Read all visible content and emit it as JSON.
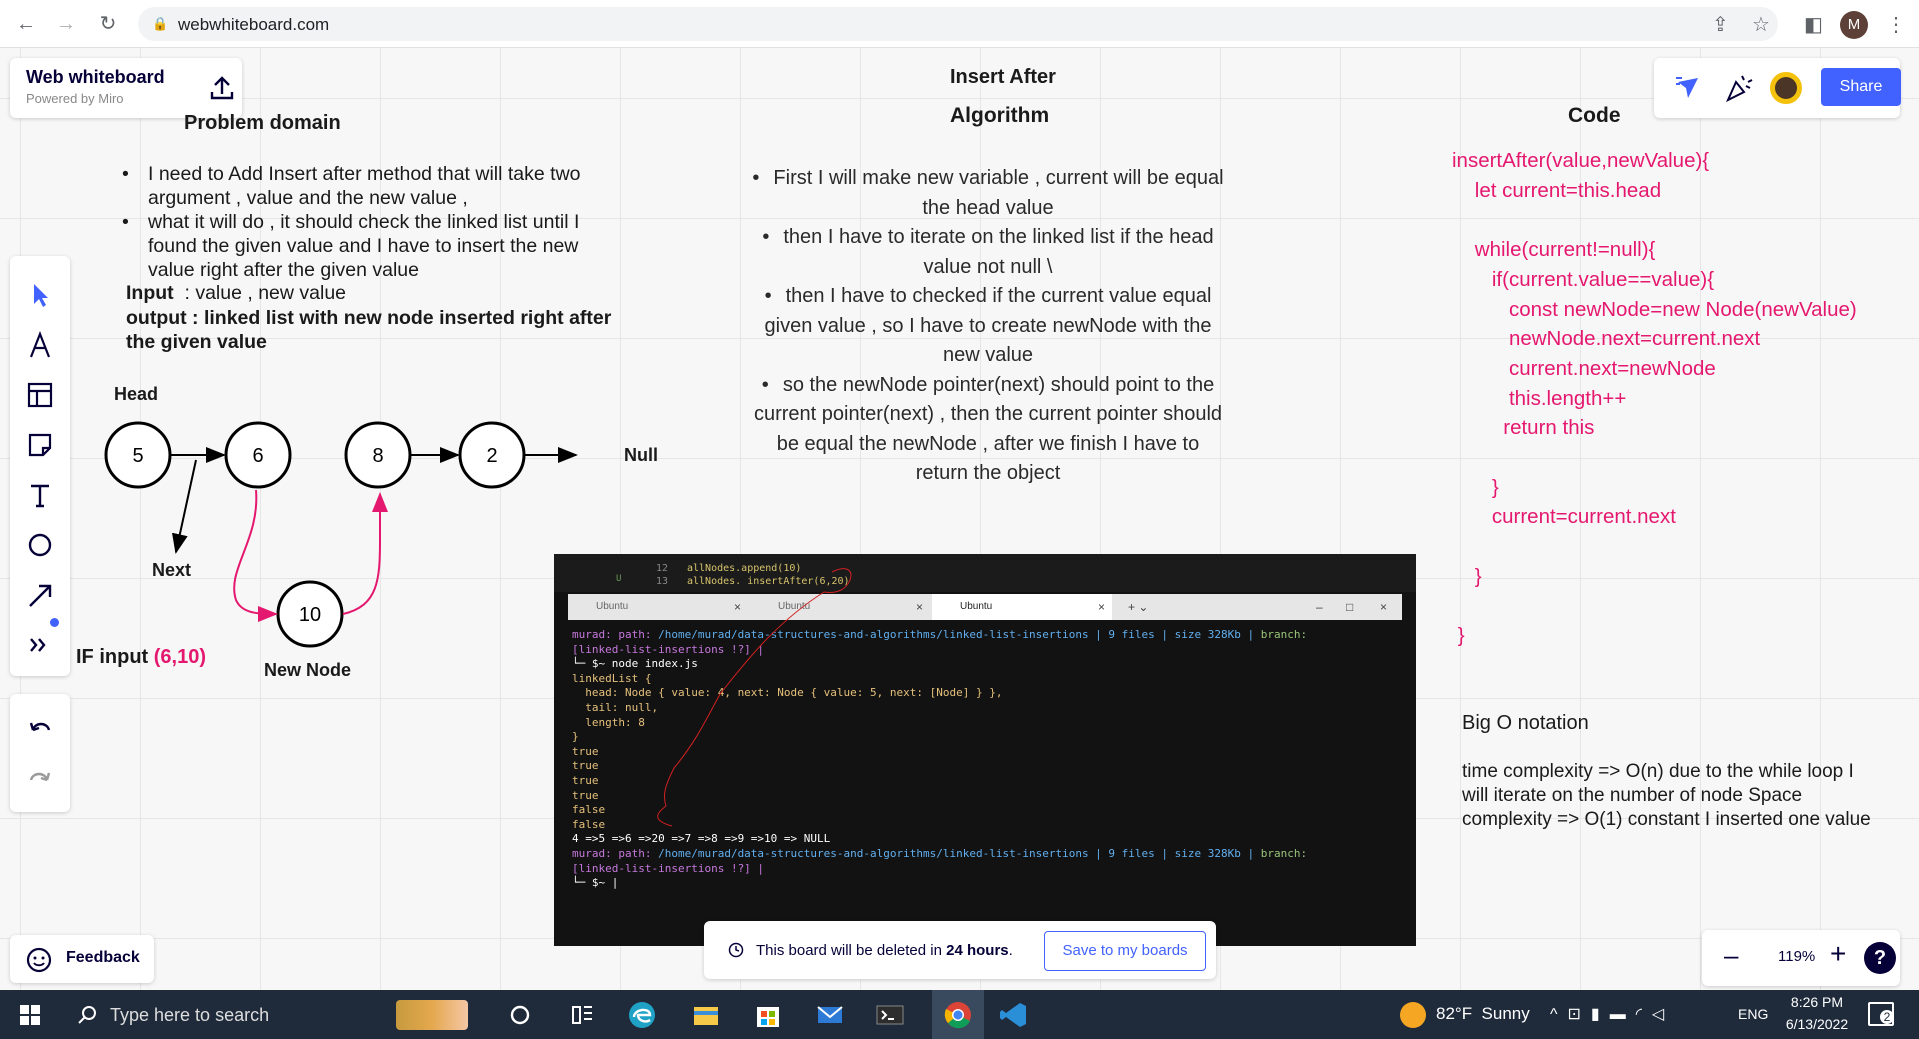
{
  "browser": {
    "url": "webwhiteboard.com",
    "profile_initial": "M"
  },
  "brand": {
    "title": "Web whiteboard",
    "subtitle": "Powered by Miro"
  },
  "share_label": "Share",
  "problem": {
    "title": "Problem domain",
    "bullets": [
      "I need to Add Insert after method that will take two argument , value and the new value ,",
      "what it will do , it should check the linked list until I found the given value and I have to insert the new value right after the given value"
    ],
    "input_label": "Input",
    "input_text": "  : value , new value",
    "output_text": "output : linked list with new node inserted right after the given value"
  },
  "algorithm": {
    "heading": "Insert After",
    "title": "Algorithm",
    "bullets": [
      "First I will make new variable , current will be equal the head value",
      "then I have to iterate on the linked list if the head value not null \\",
      "then I have to checked if the current value equal given value , so I have to create newNode with the new value",
      "so the newNode pointer(next) should point to the current pointer(next) , then the current pointer should be equal the newNode , after we finish I have to return the object"
    ]
  },
  "code": {
    "title": "Code",
    "lines": "insertAfter(value,newValue){\n    let current=this.head\n\n    while(current!=null){\n       if(current.value==value){\n          const newNode=new Node(newValue)\n          newNode.next=current.next\n          current.next=newNode\n          this.length++\n         return this\n\n       }\n       current=current.next\n\n    }\n\n }"
  },
  "diagram": {
    "head_label": "Head",
    "next_label": "Next",
    "null_label": "Null",
    "new_node_label": "New Node",
    "nodes": [
      "5",
      "6",
      "8",
      "2"
    ],
    "new_node": "10",
    "if_label": "IF input ",
    "if_value": "(6,10)"
  },
  "bigo": {
    "title": "Big O notation",
    "body": "time complexity => O(n) due to the while loop I will iterate on the number of node Space complexity => O(1) constant I inserted one value"
  },
  "terminal": {
    "editor_lines": [
      {
        "num": "12",
        "code": "allNodes.append(10)"
      },
      {
        "num": "13",
        "code": "allNodes. insertAfter(6,20)"
      }
    ],
    "tabs": [
      "Ubuntu",
      "Ubuntu",
      "Ubuntu"
    ],
    "prompt_user": "murad: path: ",
    "path": "/home/murad/data-structures-and-algorithms/linked-list-insertions",
    "files_info": " | 9 files | size 328Kb | ",
    "branch_label": "branch:",
    "branch": "[linked-list-insertions !?] |",
    "command": "└─ $~ node index.js",
    "output": "linkedList {\n  head: Node { value: 4, next: Node { value: 5, next: [Node] } },\n  tail: null,\n  length: 8\n}",
    "bools": [
      "true",
      "true",
      "true",
      "true",
      "false",
      "false"
    ],
    "list_output": "4 =>5 =>6 =>20 =>7 =>8 =>9 =>10 => NULL",
    "final_prompt": "└─ $~ |"
  },
  "feedback_label": "Feedback",
  "notice": {
    "prefix": "This board will be deleted in ",
    "hours": "24 hours",
    "suffix": ".",
    "save_label": "Save to my boards"
  },
  "zoom": {
    "level": "119%"
  },
  "taskbar": {
    "search_placeholder": "Type here to search",
    "weather": "82°F  Sunny",
    "lang": "ENG",
    "time": "8:26 PM",
    "date": "6/13/2022",
    "notif_count": "2"
  },
  "colors": {
    "accent": "#4262ff",
    "pink": "#e5186f"
  }
}
